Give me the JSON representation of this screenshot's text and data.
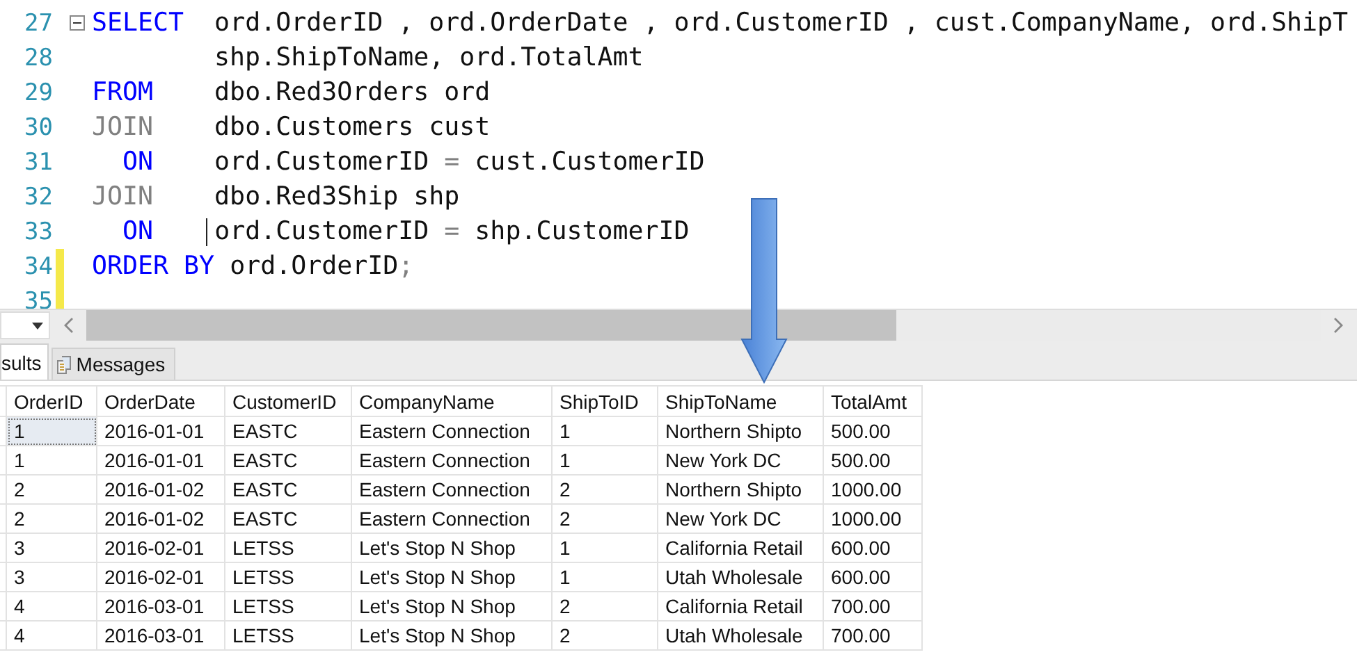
{
  "editor": {
    "lines": [
      {
        "number": "27",
        "collapsible": true,
        "changed": false,
        "caret": false,
        "tokens": [
          {
            "kind": "keyword",
            "text": "SELECT"
          },
          {
            "kind": "plain",
            "text": "  ord.OrderID , ord.OrderDate , ord.CustomerID , cust.CompanyName, ord.ShipT"
          }
        ]
      },
      {
        "number": "28",
        "collapsible": false,
        "changed": false,
        "caret": false,
        "tokens": [
          {
            "kind": "plain",
            "text": "        shp.ShipToName, ord.TotalAmt"
          }
        ]
      },
      {
        "number": "29",
        "collapsible": false,
        "changed": false,
        "caret": false,
        "tokens": [
          {
            "kind": "keyword",
            "text": "FROM"
          },
          {
            "kind": "plain",
            "text": "    dbo.Red3Orders ord"
          }
        ]
      },
      {
        "number": "30",
        "collapsible": false,
        "changed": false,
        "caret": false,
        "tokens": [
          {
            "kind": "operator",
            "text": "JOIN"
          },
          {
            "kind": "plain",
            "text": "    dbo.Customers cust"
          }
        ]
      },
      {
        "number": "31",
        "collapsible": false,
        "changed": false,
        "caret": false,
        "tokens": [
          {
            "kind": "keyword",
            "text": "  ON"
          },
          {
            "kind": "plain",
            "text": "    ord.CustomerID "
          },
          {
            "kind": "operator",
            "text": "="
          },
          {
            "kind": "plain",
            "text": " cust.CustomerID"
          }
        ]
      },
      {
        "number": "32",
        "collapsible": false,
        "changed": false,
        "caret": false,
        "tokens": [
          {
            "kind": "operator",
            "text": "JOIN"
          },
          {
            "kind": "plain",
            "text": "    dbo.Red3Ship shp"
          }
        ]
      },
      {
        "number": "33",
        "collapsible": false,
        "changed": false,
        "caret": true,
        "tokens": [
          {
            "kind": "keyword",
            "text": "  ON"
          },
          {
            "kind": "plain",
            "text": "    ord.CustomerID "
          },
          {
            "kind": "operator",
            "text": "="
          },
          {
            "kind": "plain",
            "text": " shp.CustomerID"
          }
        ]
      },
      {
        "number": "34",
        "collapsible": false,
        "changed": true,
        "caret": false,
        "tokens": [
          {
            "kind": "keyword",
            "text": "ORDER BY"
          },
          {
            "kind": "plain",
            "text": " ord.OrderID"
          },
          {
            "kind": "operator",
            "text": ";"
          }
        ]
      },
      {
        "number": "35",
        "collapsible": false,
        "changed": true,
        "caret": false
      }
    ]
  },
  "results": {
    "tabs": [
      {
        "label": "sults",
        "selected": true
      },
      {
        "label": "Messages",
        "selected": false
      }
    ],
    "columns": [
      "OrderID",
      "OrderDate",
      "CustomerID",
      "CompanyName",
      "ShipToID",
      "ShipToName",
      "TotalAmt"
    ],
    "rows": [
      {
        "selected": true,
        "cells": [
          "1",
          "2016-01-01",
          "EASTC",
          "Eastern Connection",
          "1",
          "Northern Shipto",
          "500.00"
        ]
      },
      {
        "selected": false,
        "cells": [
          "1",
          "2016-01-01",
          "EASTC",
          "Eastern Connection",
          "1",
          "New York DC",
          "500.00"
        ]
      },
      {
        "selected": false,
        "cells": [
          "2",
          "2016-01-02",
          "EASTC",
          "Eastern Connection",
          "2",
          "Northern Shipto",
          "1000.00"
        ]
      },
      {
        "selected": false,
        "cells": [
          "2",
          "2016-01-02",
          "EASTC",
          "Eastern Connection",
          "2",
          "New York DC",
          "1000.00"
        ]
      },
      {
        "selected": false,
        "cells": [
          "3",
          "2016-02-01",
          "LETSS",
          "Let's Stop N Shop",
          "1",
          "California Retail",
          "600.00"
        ]
      },
      {
        "selected": false,
        "cells": [
          "3",
          "2016-02-01",
          "LETSS",
          "Let's Stop N Shop",
          "1",
          "Utah Wholesale",
          "600.00"
        ]
      },
      {
        "selected": false,
        "cells": [
          "4",
          "2016-03-01",
          "LETSS",
          "Let's Stop N Shop",
          "2",
          "California Retail",
          "700.00"
        ]
      },
      {
        "selected": false,
        "cells": [
          "4",
          "2016-03-01",
          "LETSS",
          "Let's Stop N Shop",
          "2",
          "Utah Wholesale",
          "700.00"
        ]
      }
    ]
  }
}
